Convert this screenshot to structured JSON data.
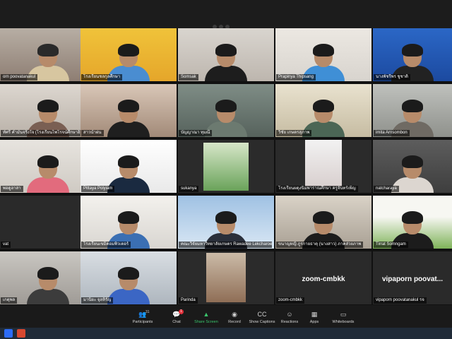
{
  "colors": {
    "accent_green": "#39c46b",
    "active_border": "#e6d66a",
    "badge_red": "#e0313b"
  },
  "participants": [
    {
      "name": "orn poovatanakul"
    },
    {
      "name": "โรงเรียนชลกุลศึกษา"
    },
    {
      "name": "Somsak"
    },
    {
      "name": "Prapinya Thipsang"
    },
    {
      "name": "นางพัชรีพร ชูชาติ"
    },
    {
      "name": "ทัศรี คำมั่นจริงใจ (โรงเรียนไพโรจน์ศึกษาอิสลามสูง)"
    },
    {
      "name": "สาวน้ำฝน"
    },
    {
      "name": "บัญญาณา ทุมณี"
    },
    {
      "name": "วิชัย เกษตรสุภาพ"
    },
    {
      "name": "imita Arnsombon"
    },
    {
      "name": "พอดูฮาสา"
    },
    {
      "name": "Pittaya Polyiam"
    },
    {
      "name": "sukanya"
    },
    {
      "name": "โรงเรียนผดุงนิมพาราณศึกษา ครูจันทร์เพ็ญ"
    },
    {
      "name": "natcharaya"
    },
    {
      "name": "vat"
    },
    {
      "name": "โรงเรียนเขมิคอมพิวเตอร์"
    },
    {
      "name": "คณะวิจัยมหาวิทยาลัยเกษตร Rawadee Lekcharoen"
    },
    {
      "name": "ขนาญหญิ ภูรกายธาตุ (นางสาว) ภาคส่วยภาพ"
    },
    {
      "name": "Tirrat Somngam"
    },
    {
      "name": "เกตุพล"
    },
    {
      "name": "มานิยะ จุลหิรัญ"
    },
    {
      "name": "Parinda"
    },
    {
      "name": "zoom-cmbkk",
      "center": "zoom-cmbkk"
    },
    {
      "name": "vipaporn poovatanakul รจ",
      "center": "vipaporn poovat..."
    }
  ],
  "toolbar": {
    "participants": "Participants",
    "participants_count": "31",
    "chat": "Chat",
    "chat_badge": "1",
    "share_screen": "Share Screen",
    "record": "Record",
    "show_captions": "Show Captions",
    "reactions": "Reactions",
    "apps": "Apps",
    "whiteboards": "Whiteboards"
  },
  "icons": {
    "participants": "people-icon",
    "chat": "chat-icon",
    "share_screen": "share-screen-icon",
    "record": "record-icon",
    "show_captions": "captions-icon",
    "reactions": "reactions-icon",
    "apps": "apps-icon",
    "whiteboards": "whiteboard-icon"
  }
}
